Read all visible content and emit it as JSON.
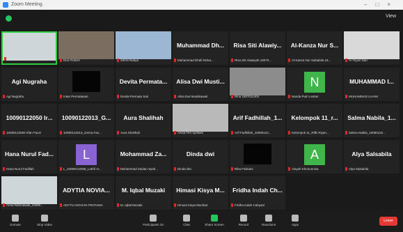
{
  "window": {
    "title": "Zoom Meeting"
  },
  "topbar": {
    "view_label": "View"
  },
  "tiles": [
    {
      "name": "",
      "label": "Zoom User",
      "kind": "photo",
      "active": true
    },
    {
      "name": "",
      "label": "Diaz Robert",
      "kind": "photo"
    },
    {
      "name": "",
      "label": "Zahra Nadya",
      "kind": "photo"
    },
    {
      "name": "Muhammad Dh...",
      "label": "Muhammad Dhafi Rizka...",
      "kind": "text"
    },
    {
      "name": "Risa Siti Alawiy...",
      "label": "Risa Siti Alawiyah 18070...",
      "kind": "text"
    },
    {
      "name": "Al-Kanza Nur S...",
      "label": "Al-Kanza Nur Salsabila 18...",
      "kind": "text"
    },
    {
      "name": "",
      "label": "Ai Yuyun Sari",
      "kind": "photo"
    },
    {
      "name": "Agi Nugraha",
      "label": "Agi Nugraha",
      "kind": "text"
    },
    {
      "name": "",
      "label": "Intan Permatasari",
      "kind": "black"
    },
    {
      "name": "Devita Permata...",
      "label": "Devita Permata Sari",
      "kind": "text"
    },
    {
      "name": "Alisa Dwi Musti...",
      "label": "Alisa Dwi Mustikawati",
      "kind": "text"
    },
    {
      "name": "",
      "label": "Rina 1807011404",
      "kind": "photo"
    },
    {
      "name": "N",
      "label": "Nanda Putri Lestari",
      "kind": "letter",
      "color": "#3fb54a"
    },
    {
      "name": "MUHAMMAD I...",
      "label": "MUHAMMAD ILHAM",
      "kind": "text"
    },
    {
      "name": "10090122050 Ir...",
      "label": "10090122050 Irfan Fauzi",
      "kind": "text"
    },
    {
      "name": "10090122013_G...",
      "label": "10090122013_Gema Fau...",
      "kind": "text"
    },
    {
      "name": "Aura Shalihah",
      "label": "Aura Shalihah",
      "kind": "text"
    },
    {
      "name": "",
      "label": "Anisa Fitri Apriliani",
      "kind": "photo"
    },
    {
      "name": "Arif Fadhillah_1...",
      "label": "Arif Fadhillah_10090122...",
      "kind": "text"
    },
    {
      "name": "Kelompok 11_r...",
      "label": "Kelompok 11_Rifki Riyan...",
      "kind": "text"
    },
    {
      "name": "Salma Nabila_1...",
      "label": "Salma Nabila_10090122...",
      "kind": "text"
    },
    {
      "name": "Hana Nurul Fad...",
      "label": "Hana Nurul Fadillah",
      "kind": "text"
    },
    {
      "name": "L",
      "label": "L_10090122058_Luthfi Ar...",
      "kind": "letter",
      "color": "#8a63d2"
    },
    {
      "name": "Mohammad Za...",
      "label": "Mohammad Zaidan Syah...",
      "kind": "text"
    },
    {
      "name": "Dinda dwi",
      "label": "Dinda dwi",
      "kind": "text"
    },
    {
      "name": "",
      "label": "Rika Febriani",
      "kind": "black"
    },
    {
      "name": "A",
      "label": "Aisyah Khoirunnisa",
      "kind": "letter",
      "color": "#3fb54a"
    },
    {
      "name": "Alya Salsabila",
      "label": "Alya Salsabila",
      "kind": "text"
    },
    {
      "name": "",
      "label": "Anna Rahmawati_10090...",
      "kind": "photo"
    },
    {
      "name": "ADYTIA NOVIA...",
      "label": "ADYTIA NOVIAN PRATAMA",
      "kind": "text"
    },
    {
      "name": "M. Iqbal Muzaki",
      "label": "M. Iqbal Muzaki",
      "kind": "text"
    },
    {
      "name": "Himasi Kisya M...",
      "label": "Himasi Kisya Muchtar",
      "kind": "text"
    },
    {
      "name": "Fridha Indah Ch...",
      "label": "Fridha Indah Cahyani",
      "kind": "text"
    }
  ],
  "toolbar": {
    "unmute": "Unmute",
    "stop_video": "Stop Video",
    "participants": "Participants",
    "participants_count": "33",
    "chat": "Chat",
    "share_screen": "Share Screen",
    "record": "Record",
    "reactions": "Reactions",
    "apps": "Apps",
    "leave": "Leave"
  }
}
